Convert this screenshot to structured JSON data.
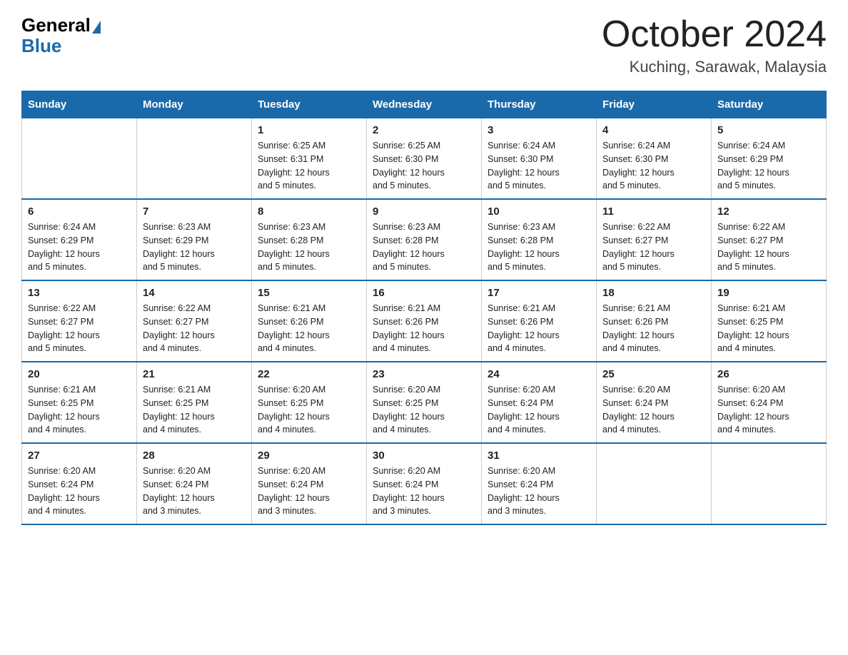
{
  "logo": {
    "general": "General",
    "blue": "Blue",
    "triangle": "▲"
  },
  "title": "October 2024",
  "subtitle": "Kuching, Sarawak, Malaysia",
  "weekdays": [
    "Sunday",
    "Monday",
    "Tuesday",
    "Wednesday",
    "Thursday",
    "Friday",
    "Saturday"
  ],
  "weeks": [
    [
      {
        "day": "",
        "info": ""
      },
      {
        "day": "",
        "info": ""
      },
      {
        "day": "1",
        "info": "Sunrise: 6:25 AM\nSunset: 6:31 PM\nDaylight: 12 hours\nand 5 minutes."
      },
      {
        "day": "2",
        "info": "Sunrise: 6:25 AM\nSunset: 6:30 PM\nDaylight: 12 hours\nand 5 minutes."
      },
      {
        "day": "3",
        "info": "Sunrise: 6:24 AM\nSunset: 6:30 PM\nDaylight: 12 hours\nand 5 minutes."
      },
      {
        "day": "4",
        "info": "Sunrise: 6:24 AM\nSunset: 6:30 PM\nDaylight: 12 hours\nand 5 minutes."
      },
      {
        "day": "5",
        "info": "Sunrise: 6:24 AM\nSunset: 6:29 PM\nDaylight: 12 hours\nand 5 minutes."
      }
    ],
    [
      {
        "day": "6",
        "info": "Sunrise: 6:24 AM\nSunset: 6:29 PM\nDaylight: 12 hours\nand 5 minutes."
      },
      {
        "day": "7",
        "info": "Sunrise: 6:23 AM\nSunset: 6:29 PM\nDaylight: 12 hours\nand 5 minutes."
      },
      {
        "day": "8",
        "info": "Sunrise: 6:23 AM\nSunset: 6:28 PM\nDaylight: 12 hours\nand 5 minutes."
      },
      {
        "day": "9",
        "info": "Sunrise: 6:23 AM\nSunset: 6:28 PM\nDaylight: 12 hours\nand 5 minutes."
      },
      {
        "day": "10",
        "info": "Sunrise: 6:23 AM\nSunset: 6:28 PM\nDaylight: 12 hours\nand 5 minutes."
      },
      {
        "day": "11",
        "info": "Sunrise: 6:22 AM\nSunset: 6:27 PM\nDaylight: 12 hours\nand 5 minutes."
      },
      {
        "day": "12",
        "info": "Sunrise: 6:22 AM\nSunset: 6:27 PM\nDaylight: 12 hours\nand 5 minutes."
      }
    ],
    [
      {
        "day": "13",
        "info": "Sunrise: 6:22 AM\nSunset: 6:27 PM\nDaylight: 12 hours\nand 5 minutes."
      },
      {
        "day": "14",
        "info": "Sunrise: 6:22 AM\nSunset: 6:27 PM\nDaylight: 12 hours\nand 4 minutes."
      },
      {
        "day": "15",
        "info": "Sunrise: 6:21 AM\nSunset: 6:26 PM\nDaylight: 12 hours\nand 4 minutes."
      },
      {
        "day": "16",
        "info": "Sunrise: 6:21 AM\nSunset: 6:26 PM\nDaylight: 12 hours\nand 4 minutes."
      },
      {
        "day": "17",
        "info": "Sunrise: 6:21 AM\nSunset: 6:26 PM\nDaylight: 12 hours\nand 4 minutes."
      },
      {
        "day": "18",
        "info": "Sunrise: 6:21 AM\nSunset: 6:26 PM\nDaylight: 12 hours\nand 4 minutes."
      },
      {
        "day": "19",
        "info": "Sunrise: 6:21 AM\nSunset: 6:25 PM\nDaylight: 12 hours\nand 4 minutes."
      }
    ],
    [
      {
        "day": "20",
        "info": "Sunrise: 6:21 AM\nSunset: 6:25 PM\nDaylight: 12 hours\nand 4 minutes."
      },
      {
        "day": "21",
        "info": "Sunrise: 6:21 AM\nSunset: 6:25 PM\nDaylight: 12 hours\nand 4 minutes."
      },
      {
        "day": "22",
        "info": "Sunrise: 6:20 AM\nSunset: 6:25 PM\nDaylight: 12 hours\nand 4 minutes."
      },
      {
        "day": "23",
        "info": "Sunrise: 6:20 AM\nSunset: 6:25 PM\nDaylight: 12 hours\nand 4 minutes."
      },
      {
        "day": "24",
        "info": "Sunrise: 6:20 AM\nSunset: 6:24 PM\nDaylight: 12 hours\nand 4 minutes."
      },
      {
        "day": "25",
        "info": "Sunrise: 6:20 AM\nSunset: 6:24 PM\nDaylight: 12 hours\nand 4 minutes."
      },
      {
        "day": "26",
        "info": "Sunrise: 6:20 AM\nSunset: 6:24 PM\nDaylight: 12 hours\nand 4 minutes."
      }
    ],
    [
      {
        "day": "27",
        "info": "Sunrise: 6:20 AM\nSunset: 6:24 PM\nDaylight: 12 hours\nand 4 minutes."
      },
      {
        "day": "28",
        "info": "Sunrise: 6:20 AM\nSunset: 6:24 PM\nDaylight: 12 hours\nand 3 minutes."
      },
      {
        "day": "29",
        "info": "Sunrise: 6:20 AM\nSunset: 6:24 PM\nDaylight: 12 hours\nand 3 minutes."
      },
      {
        "day": "30",
        "info": "Sunrise: 6:20 AM\nSunset: 6:24 PM\nDaylight: 12 hours\nand 3 minutes."
      },
      {
        "day": "31",
        "info": "Sunrise: 6:20 AM\nSunset: 6:24 PM\nDaylight: 12 hours\nand 3 minutes."
      },
      {
        "day": "",
        "info": ""
      },
      {
        "day": "",
        "info": ""
      }
    ]
  ]
}
